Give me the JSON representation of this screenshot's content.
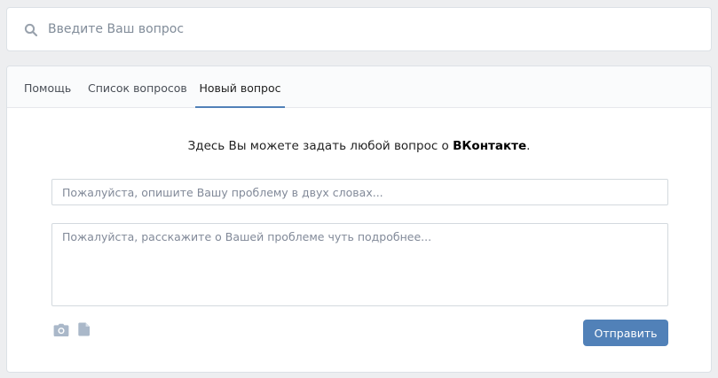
{
  "search": {
    "placeholder": "Введите Ваш вопрос",
    "icon": "search-icon"
  },
  "tabs": [
    {
      "label": "Помощь",
      "active": false
    },
    {
      "label": "Список вопросов",
      "active": false
    },
    {
      "label": "Новый вопрос",
      "active": true
    }
  ],
  "form": {
    "intro_text": "Здесь Вы можете задать любой вопрос о ",
    "intro_brand": "ВКонтакте",
    "intro_end": ".",
    "title_placeholder": "Пожалуйста, опишите Вашу проблему в двух словах...",
    "description_placeholder": "Пожалуйста, расскажите о Вашей проблеме чуть подробнее...",
    "attachments": [
      "camera-icon",
      "document-icon"
    ],
    "submit_label": "Отправить"
  },
  "colors": {
    "accent": "#5181b8",
    "background": "#edeef0",
    "icon": "#aab8c9"
  }
}
